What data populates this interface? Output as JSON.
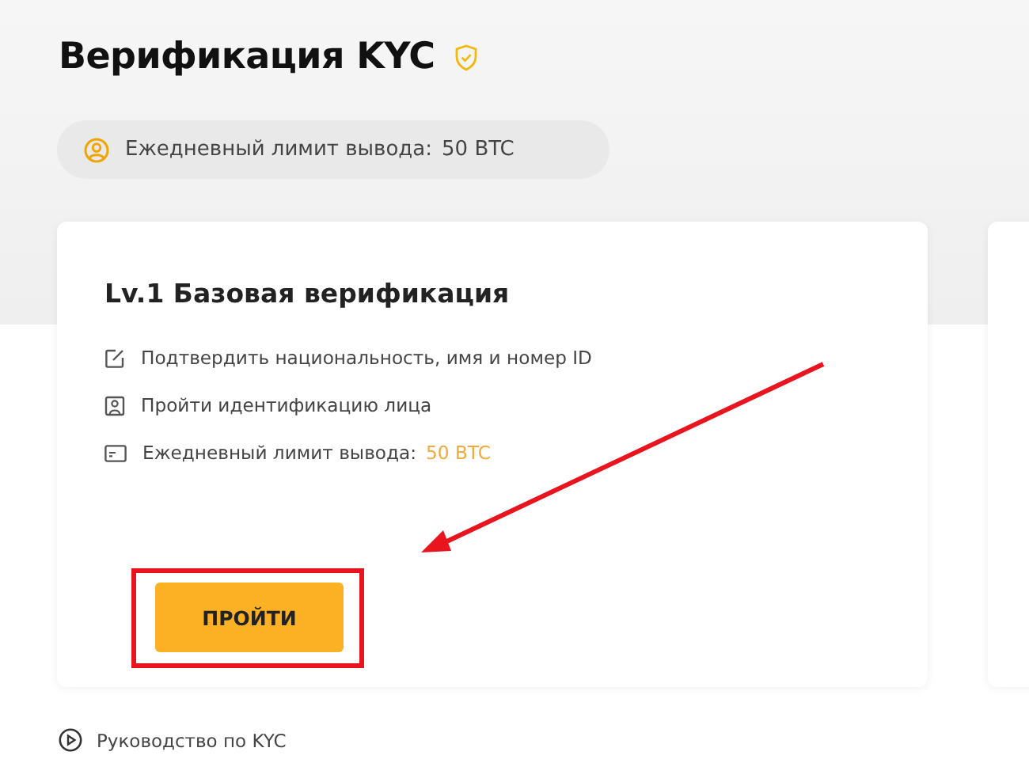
{
  "page_title": "Верификация KYC",
  "limit_pill": {
    "label": "Ежедневный лимит вывода:",
    "value": "50 BTC"
  },
  "level_card": {
    "title": "Lv.1 Базовая верификация",
    "requirements": [
      {
        "kind": "edit",
        "label": "Подтвердить национальность, имя и номер ID"
      },
      {
        "kind": "face",
        "label": "Пройти идентификацию лица"
      },
      {
        "kind": "card",
        "label": "Ежедневный лимит вывода:",
        "value": "50 BTC"
      }
    ],
    "button": "ПРОЙТИ"
  },
  "guide_link": "Руководство по KYC"
}
